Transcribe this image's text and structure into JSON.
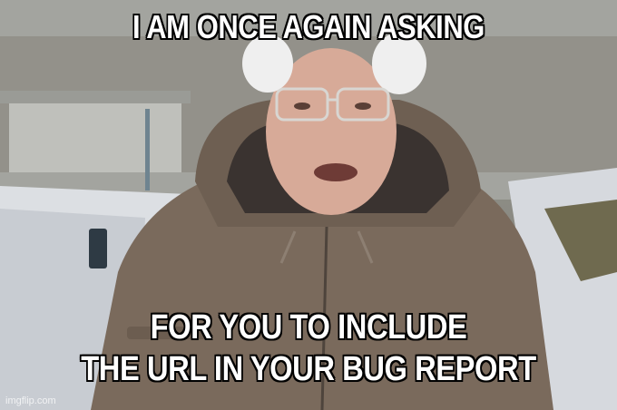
{
  "meme": {
    "top_text": "I AM ONCE AGAIN ASKING",
    "bottom_text_line1": "FOR YOU TO INCLUDE",
    "bottom_text_line2": "THE URL IN YOUR BUG REPORT",
    "watermark": "imgflip.com"
  },
  "colors": {
    "caption_fill": "#ffffff",
    "caption_outline": "#000000",
    "jacket": "#7a6a5c",
    "snow": "#e4e6ea",
    "sky": "#a8aaa6"
  }
}
